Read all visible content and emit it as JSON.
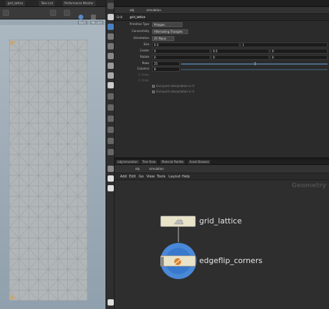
{
  "viewport": {
    "tabs": [
      "grid_lattice",
      "Take List",
      "Performance Monitor"
    ],
    "chips": [
      "Back",
      "No cam"
    ]
  },
  "params": {
    "path": "obj",
    "path_node": "simulation",
    "node_type": "Grid",
    "node_name": "grid_lattice",
    "fields": {
      "primitive_type_label": "Primitive Type",
      "primitive_type_value": "Polygon",
      "connectivity_label": "Connectivity",
      "connectivity_value": "Alternating Triangles",
      "orientation_label": "Orientation",
      "orientation_value": "XY Plane",
      "size_label": "Size",
      "size_x": "0.3",
      "size_y": "1",
      "center_label": "Center",
      "center_x": "0",
      "center_y": "0.5",
      "center_z": "0",
      "rotate_label": "Rotate",
      "rotate_x": "0",
      "rotate_y": "0",
      "rotate_z": "0",
      "rows_label": "Rows",
      "rows_value": "25",
      "rows_fraction": 0.5,
      "columns_label": "Columns",
      "columns_value": "8",
      "u_order_label": "U Order",
      "v_order_label": "V Order",
      "end_u_label": "End point interpolation in U",
      "end_v_label": "End point interpolation in V"
    }
  },
  "network": {
    "tabs": [
      "/obj/simulation",
      "Tree View",
      "Material Palette",
      "Asset Browser"
    ],
    "path": "obj",
    "path_node": "simulation",
    "menu": [
      "Add",
      "Edit",
      "Go",
      "View",
      "Tools",
      "Layout",
      "Help"
    ],
    "watermark": "Geometry",
    "nodes": [
      {
        "name": "grid_lattice",
        "icon": "grid-icon"
      },
      {
        "name": "edgeflip_corners",
        "icon": "edgeflip-icon"
      }
    ]
  },
  "colors": {
    "selected_node": "#e8e3c8",
    "active_ring": "#4a88d8",
    "accent_orange": "#d9822b"
  }
}
